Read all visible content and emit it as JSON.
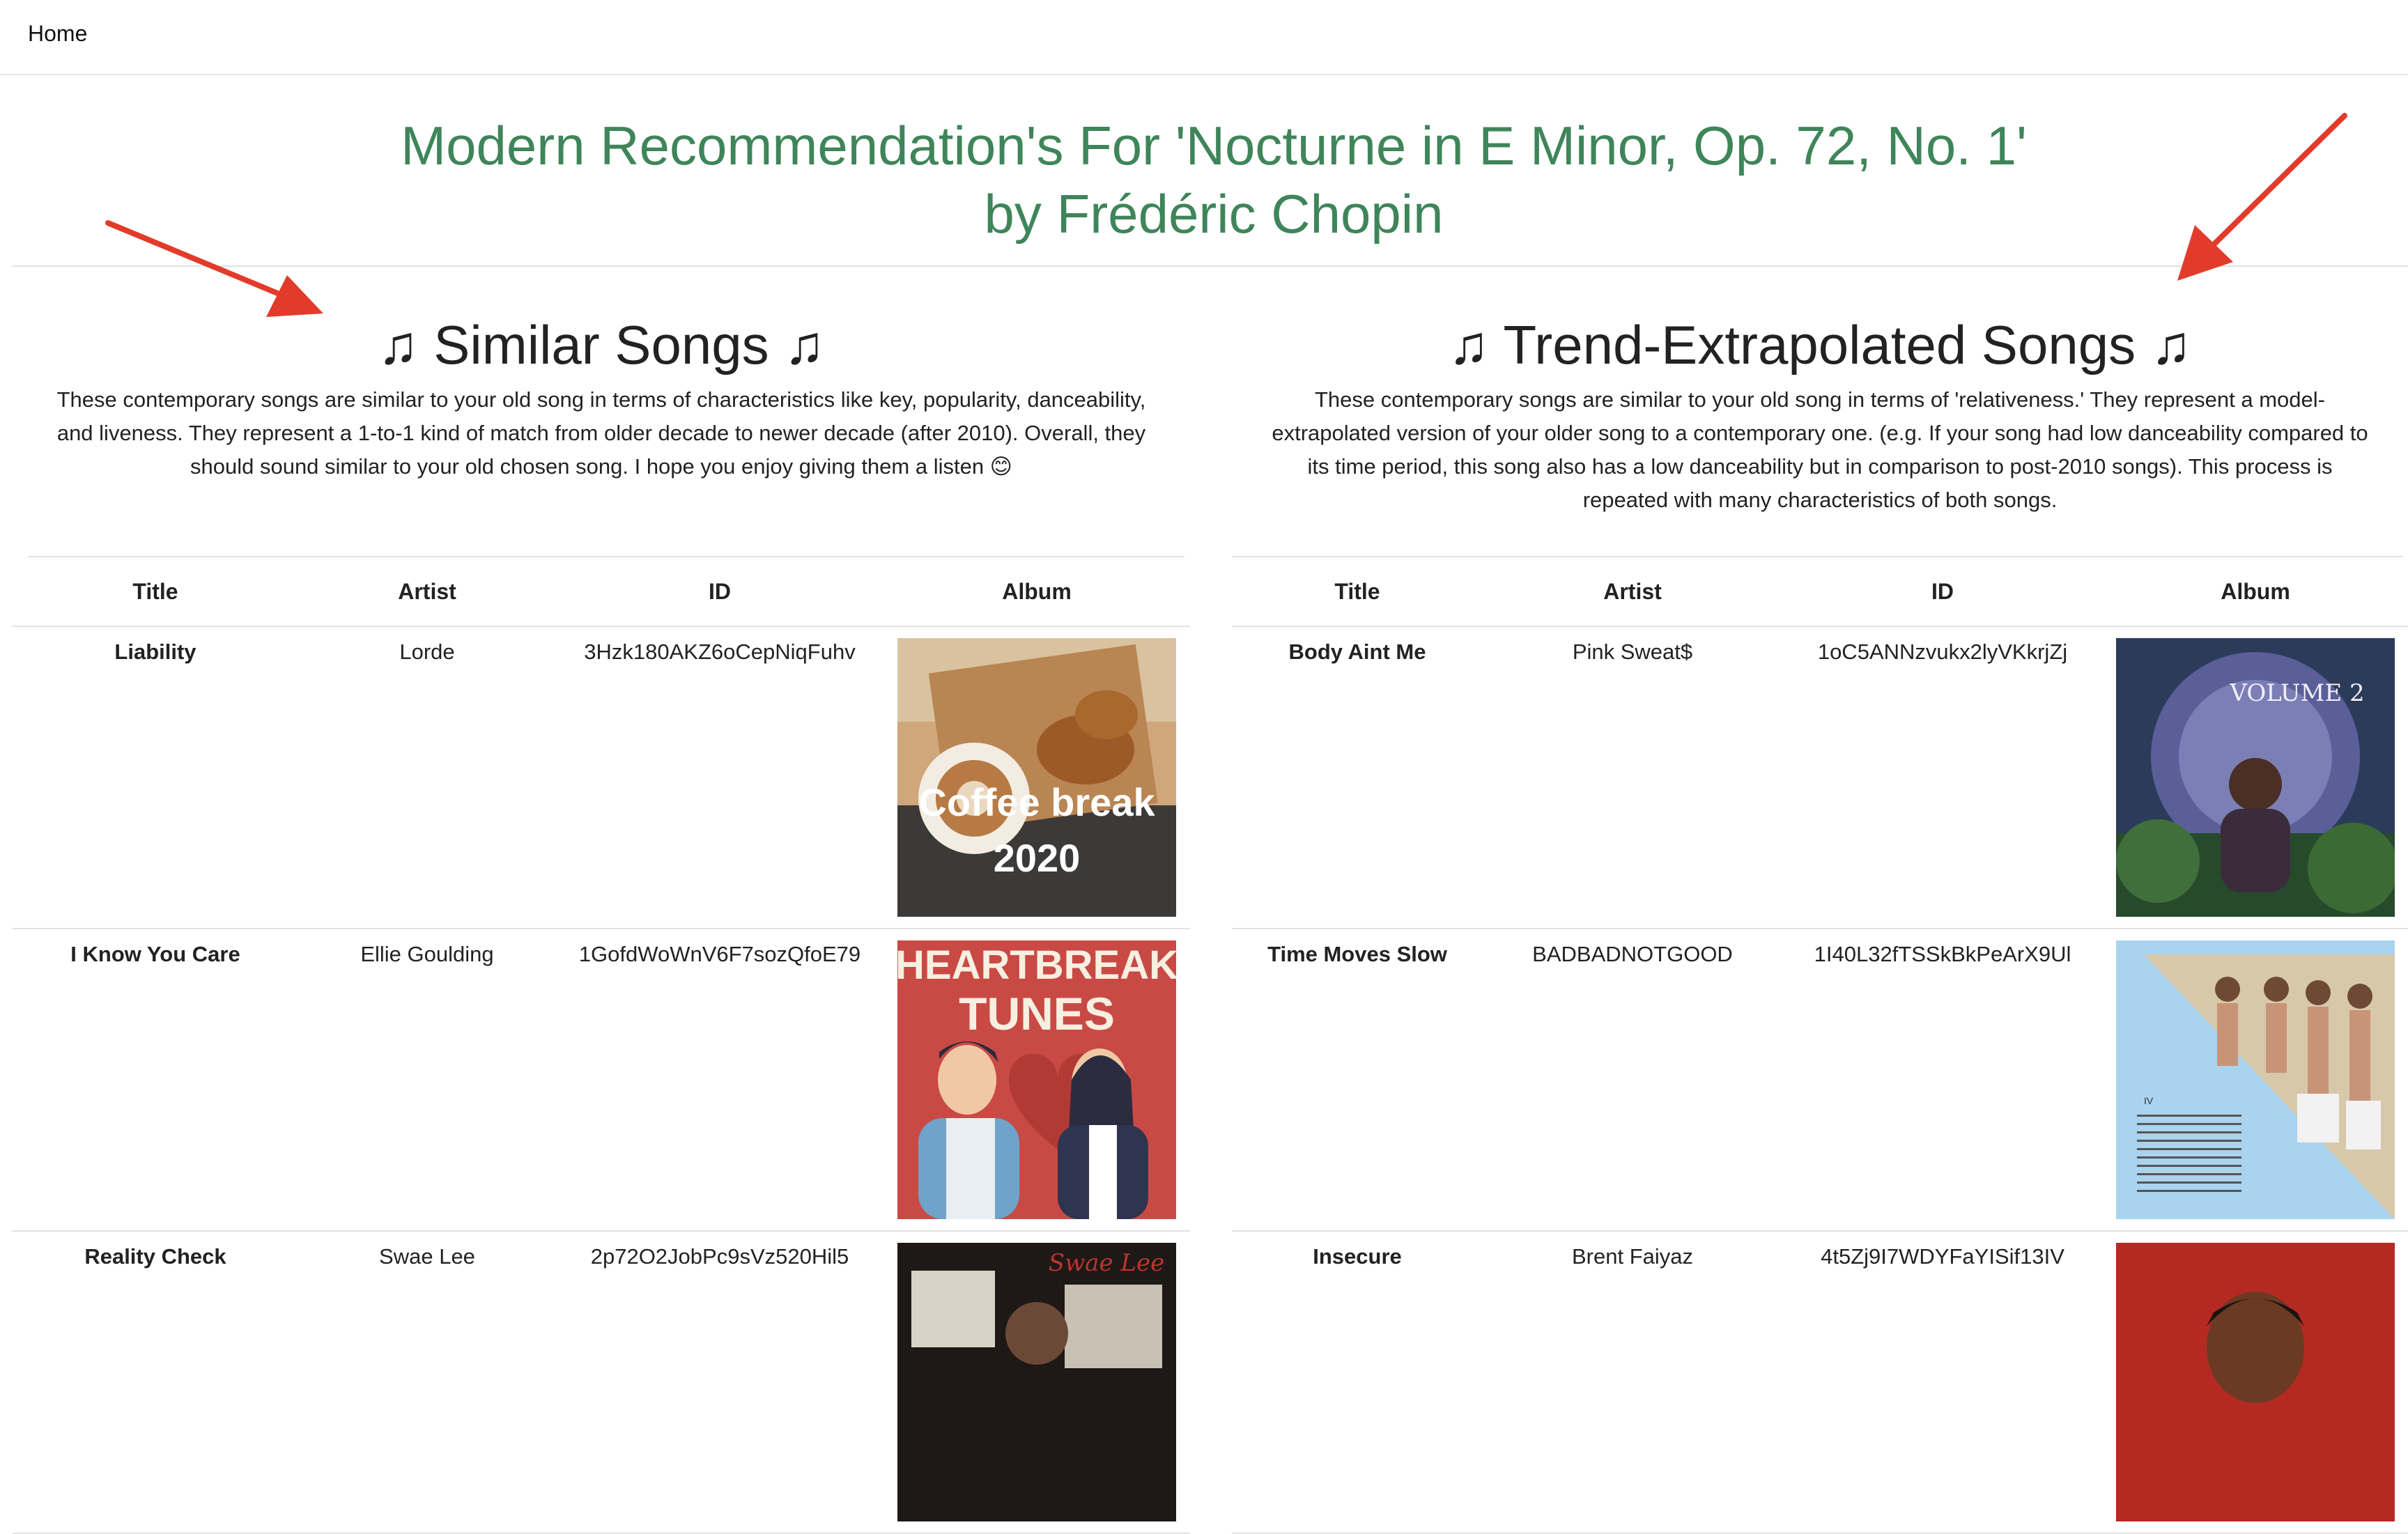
{
  "nav": {
    "home_label": "Home"
  },
  "page": {
    "title_line1": "Modern Recommendation's For 'Nocturne in E Minor, Op. 72, No. 1'",
    "title_line2": "by Frédéric Chopin"
  },
  "colors": {
    "title_green": "#3f855a",
    "arrow_red": "#e33b2b",
    "divider": "#e2e2e2"
  },
  "similar": {
    "heading": "Similar Songs",
    "note_icon": "♫",
    "description": "These contemporary songs are similar to your old song in terms of characteristics like key, popularity, danceability, and liveness. They represent a 1-to-1 kind of match from older decade to newer decade (after 2010). Overall, they should sound similar to your old chosen song. I hope you enjoy giving them a listen 😊",
    "columns": [
      "Title",
      "Artist",
      "ID",
      "Album"
    ],
    "rows": [
      {
        "title": "Liability",
        "artist": "Lorde",
        "id": "3Hzk180AKZ6oCepNiqFuhv",
        "album_text_1": "Coffee break",
        "album_text_2": "2020"
      },
      {
        "title": "I Know You Care",
        "artist": "Ellie Goulding",
        "id": "1GofdWoWnV6F7sozQfoE79",
        "album_text_1": "HEARTBREAK",
        "album_text_2": "TUNES"
      },
      {
        "title": "Reality Check",
        "artist": "Swae Lee",
        "id": "2p72O2JobPc9sVz520Hil5",
        "album_text_1": "Swae Lee",
        "album_text_2": ""
      }
    ]
  },
  "trend": {
    "heading": "Trend-Extrapolated Songs",
    "note_icon": "♫",
    "description": "These contemporary songs are similar to your old song in terms of 'relativeness.' They represent a model-extrapolated version of your older song to a contemporary one. (e.g. If your song had low danceability compared to its time period, this song also has a low danceability but in comparison to post-2010 songs). This process is repeated with many characteristics of both songs.",
    "columns": [
      "Title",
      "Artist",
      "ID",
      "Album"
    ],
    "rows": [
      {
        "title": "Body Aint Me",
        "artist": "Pink Sweat$",
        "id": "1oC5ANNzvukx2lyVKkrjZj",
        "album_text_1": "VOLUME 2",
        "album_text_2": ""
      },
      {
        "title": "Time Moves Slow",
        "artist": "BADBADNOTGOOD",
        "id": "1I40L32fTSSkBkPeArX9Ul",
        "album_text_1": "IV",
        "album_text_2": ""
      },
      {
        "title": "Insecure",
        "artist": "Brent Faiyaz",
        "id": "4t5Zj9I7WDYFaYISif13IV",
        "album_text_1": "",
        "album_text_2": ""
      }
    ]
  }
}
